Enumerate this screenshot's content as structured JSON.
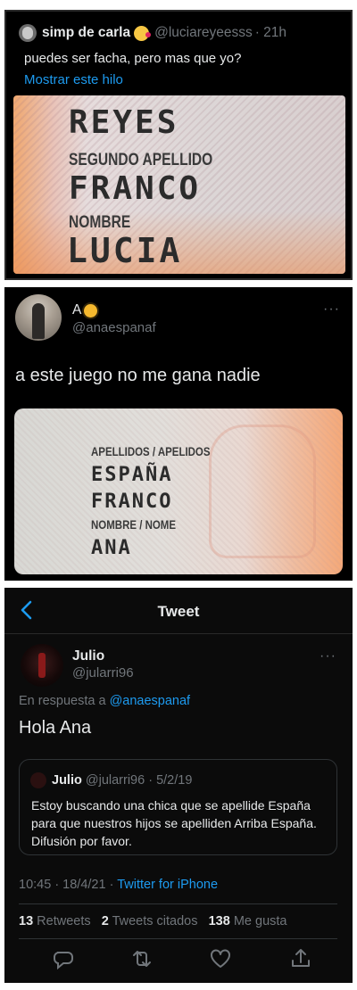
{
  "tweet1": {
    "name": "simp de carla",
    "handle": "@luciareyeesss",
    "time": "· 21h",
    "text": "puedes ser facha, pero mas que yo?",
    "thread_link": "Mostrar este hilo",
    "image": {
      "field1": "REYES",
      "label2": "SEGUNDO APELLIDO",
      "field2": "FRANCO",
      "label3": "NOMBRE",
      "field3": "LUCIA"
    }
  },
  "tweet2": {
    "name": "A",
    "handle": "@anaespanaf",
    "text": "a este juego no me gana nadie",
    "more": "···",
    "image": {
      "label1": "APELLIDOS / APELIDOS",
      "field1": "ESPAÑA",
      "field2": "FRANCO",
      "label2": "NOMBRE / NOME",
      "field3": "ANA"
    }
  },
  "tweet3": {
    "header_title": "Tweet",
    "name": "Julio",
    "handle": "@jularri96",
    "more": "···",
    "reply_prefix": "En respuesta a",
    "reply_to": "@anaespanaf",
    "text": "Hola Ana",
    "quote": {
      "name": "Julio",
      "handle": "@jularri96",
      "date": "· 5/2/19",
      "text": "Estoy buscando una chica que se apellide España para que nuestros hijos se apelliden Arriba España. Difusión por favor."
    },
    "time": "10:45 · 18/4/21 ·",
    "source": "Twitter for iPhone",
    "stats": {
      "retweets_count": "13",
      "retweets_label": "Retweets",
      "quotes_count": "2",
      "quotes_label": "Tweets citados",
      "likes_count": "138",
      "likes_label": "Me gusta"
    }
  },
  "colors": {
    "accent": "#1d9bf0",
    "background": "#000000",
    "text": "#e7e9ea",
    "muted": "#71767b"
  }
}
